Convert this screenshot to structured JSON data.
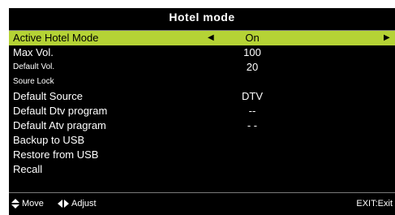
{
  "title": "Hotel mode",
  "menu": {
    "items": [
      {
        "label": "Active Hotel Mode",
        "value": "On"
      },
      {
        "label": "Max Vol.",
        "value": "100"
      },
      {
        "label": "Default Vol.",
        "value": "20"
      },
      {
        "label": "Soure Lock",
        "value": ""
      },
      {
        "label": "Default Source",
        "value": "DTV"
      },
      {
        "label": "Default Dtv program",
        "value": "--"
      },
      {
        "label": "Default Atv pragram",
        "value": "- -"
      },
      {
        "label": "Backup to USB",
        "value": ""
      },
      {
        "label": "Restore from USB",
        "value": ""
      },
      {
        "label": "Recall",
        "value": ""
      }
    ]
  },
  "footer": {
    "move_label": "Move",
    "adjust_label": "Adjust",
    "exit_label": "EXIT:Exit"
  },
  "colors": {
    "highlight": "#b5d335",
    "background": "#000000",
    "text": "#ffffff"
  },
  "icons": {
    "left_arrow": "triangle-left-icon",
    "right_arrow": "triangle-right-icon",
    "move": "up-down-arrows-icon",
    "adjust": "left-right-arrows-icon"
  }
}
